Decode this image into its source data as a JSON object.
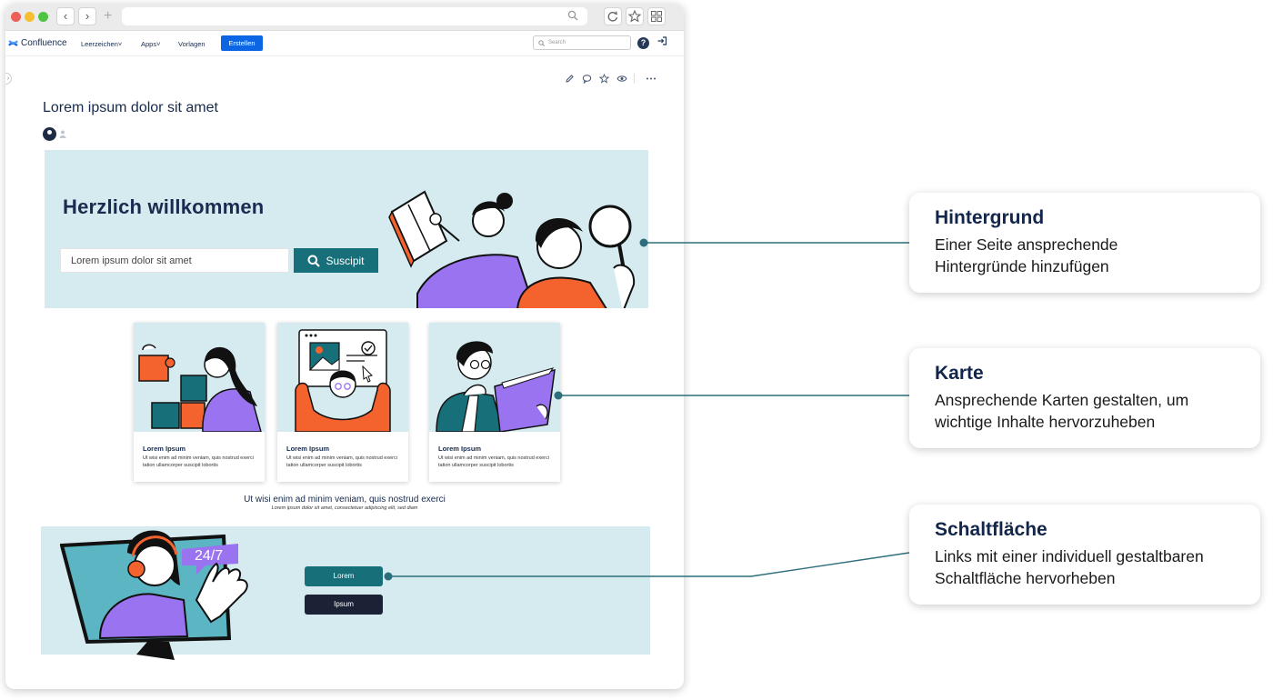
{
  "browser": {
    "new_tab_symbol": "+"
  },
  "topnav": {
    "logo_text": "Confluence",
    "menu_items": [
      {
        "label": "Leerzeichen",
        "has_dropdown": true
      },
      {
        "label": "Apps",
        "has_dropdown": true
      },
      {
        "label": "Vorlagen",
        "has_dropdown": false
      }
    ],
    "create_label": "Erstellen",
    "search_placeholder": "Search",
    "help_symbol": "?"
  },
  "page": {
    "title": "Lorem ipsum dolor sit amet",
    "hero": {
      "heading": "Herzlich willkommen",
      "input_value": "Lorem ipsum dolor sit amet",
      "button_label": "Suscipit"
    },
    "cards": [
      {
        "title": "Lorem Ipsum",
        "text": "Ut wisi enim ad minim veniam, quis nostrud exerci tation ullamcorper suscipit lobortis"
      },
      {
        "title": "Lorem Ipsum",
        "text": "Ut wisi enim ad minim veniam, quis nostrud exerci tation ullamcorper suscipit lobortis"
      },
      {
        "title": "Lorem Ipsum",
        "text": "Ut wisi enim ad minim veniam, quis nostrud exerci tation ullamcorper suscipit lobortis"
      }
    ],
    "caption_main": "Ut wisi enim ad minim veniam, quis nostrud exerci",
    "caption_sub": "Lorem ipsum dolor sit amet, consectetuer adipiscing elit, sed diam",
    "support_badge": "24/7",
    "buttons": {
      "primary": "Lorem",
      "secondary": "Ipsum"
    }
  },
  "callouts": [
    {
      "title": "Hintergrund",
      "line1": "Einer Seite ansprechende",
      "line2": "Hintergründe hinzufügen"
    },
    {
      "title": "Karte",
      "line1": "Ansprechende Karten gestalten, um",
      "line2": "wichtige Inhalte hervorzuheben"
    },
    {
      "title": "Schaltfläche",
      "line1": "Links mit einer individuell gestaltbaren",
      "line2": "Schaltfläche hervorheben"
    }
  ],
  "colors": {
    "accent_teal": "#176f7a",
    "dark_navy": "#1b2236",
    "light_blue_bg": "#d5ebf0",
    "create_blue": "#0c66e4",
    "purple": "#9a73f0",
    "orange": "#f4622e"
  },
  "icons": [
    "back-icon",
    "forward-icon",
    "search-icon",
    "reload-icon",
    "star-icon",
    "grid-icon",
    "help-icon",
    "login-icon",
    "edit-icon",
    "comment-icon",
    "watch-icon",
    "more-icon"
  ]
}
